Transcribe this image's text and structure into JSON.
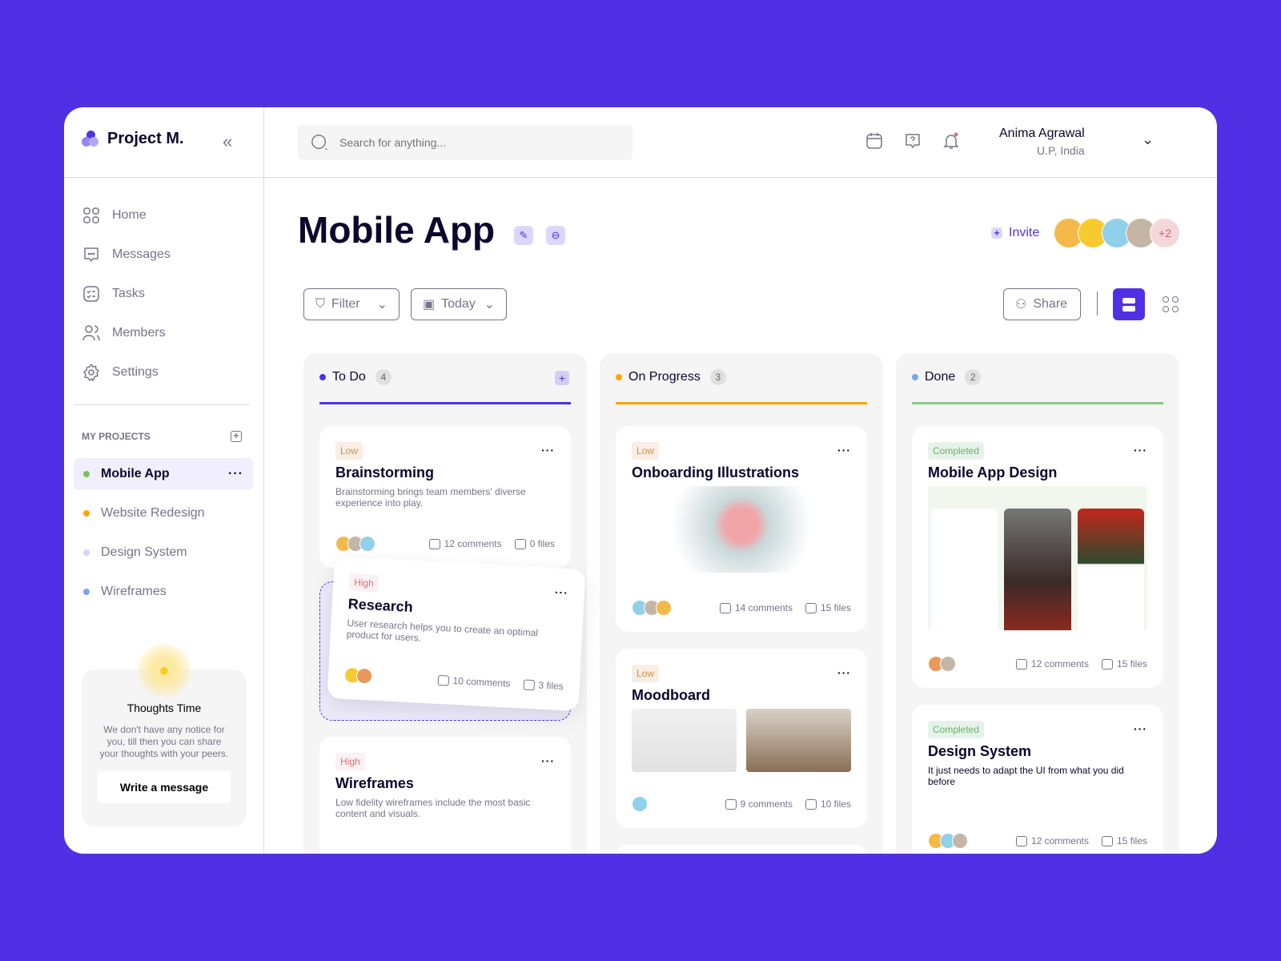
{
  "app": {
    "name": "Project M."
  },
  "sidebar": {
    "items": [
      {
        "label": "Home",
        "icon": "grid-icon"
      },
      {
        "label": "Messages",
        "icon": "chat-icon"
      },
      {
        "label": "Tasks",
        "icon": "tasks-icon"
      },
      {
        "label": "Members",
        "icon": "members-icon"
      },
      {
        "label": "Settings",
        "icon": "gear-icon"
      }
    ],
    "projects_heading": "MY PROJECTS",
    "projects": [
      {
        "label": "Mobile App",
        "color": "#7AC555",
        "active": true,
        "more": "···"
      },
      {
        "label": "Website Redesign",
        "color": "#FFA500"
      },
      {
        "label": "Design System",
        "color": "#E4CCFD"
      },
      {
        "label": "Wireframes",
        "color": "#76A5EA"
      }
    ],
    "thoughts": {
      "title": "Thoughts Time",
      "text": "We don't have any notice for you, till then you can share your thoughts with your peers.",
      "button": "Write a message"
    }
  },
  "header": {
    "search_placeholder": "Search for anything...",
    "user_name": "Anima Agrawal",
    "user_location": "U.P, India"
  },
  "page": {
    "title": "Mobile App",
    "invite": "Invite",
    "extra_members": "+2",
    "filter": "Filter",
    "today": "Today",
    "share": "Share"
  },
  "columns": [
    {
      "title": "To Do",
      "count": "4",
      "color": "#5030E5",
      "cards": [
        {
          "tag": "Low",
          "title": "Brainstorming",
          "desc": "Brainstorming brings team members' diverse experience into play.",
          "comments": "12 comments",
          "files": "0 files"
        },
        {
          "tag": "High",
          "title": "Research",
          "desc": "User research helps you to create an optimal product for users.",
          "comments": "10 comments",
          "files": "3 files"
        },
        {
          "tag": "High",
          "title": "Wireframes",
          "desc": "Low fidelity wireframes include the most basic content and visuals."
        }
      ]
    },
    {
      "title": "On Progress",
      "count": "3",
      "color": "#FFA500",
      "cards": [
        {
          "tag": "Low",
          "title": "Onboarding Illustrations",
          "comments": "14 comments",
          "files": "15 files"
        },
        {
          "tag": "Low",
          "title": "Moodboard",
          "comments": "9 comments",
          "files": "10 files"
        }
      ]
    },
    {
      "title": "Done",
      "count": "2",
      "color": "#8BC48A",
      "cards": [
        {
          "tag": "Completed",
          "title": "Mobile App Design",
          "comments": "12 comments",
          "files": "15 files"
        },
        {
          "tag": "Completed",
          "title": "Design System",
          "desc": "It just needs to adapt the UI from what you did before",
          "comments": "12 comments",
          "files": "15 files"
        }
      ]
    }
  ],
  "colors": {
    "background": "#5030E5",
    "accent": "#5030E5",
    "text": "#0D062D",
    "muted": "#787486"
  }
}
